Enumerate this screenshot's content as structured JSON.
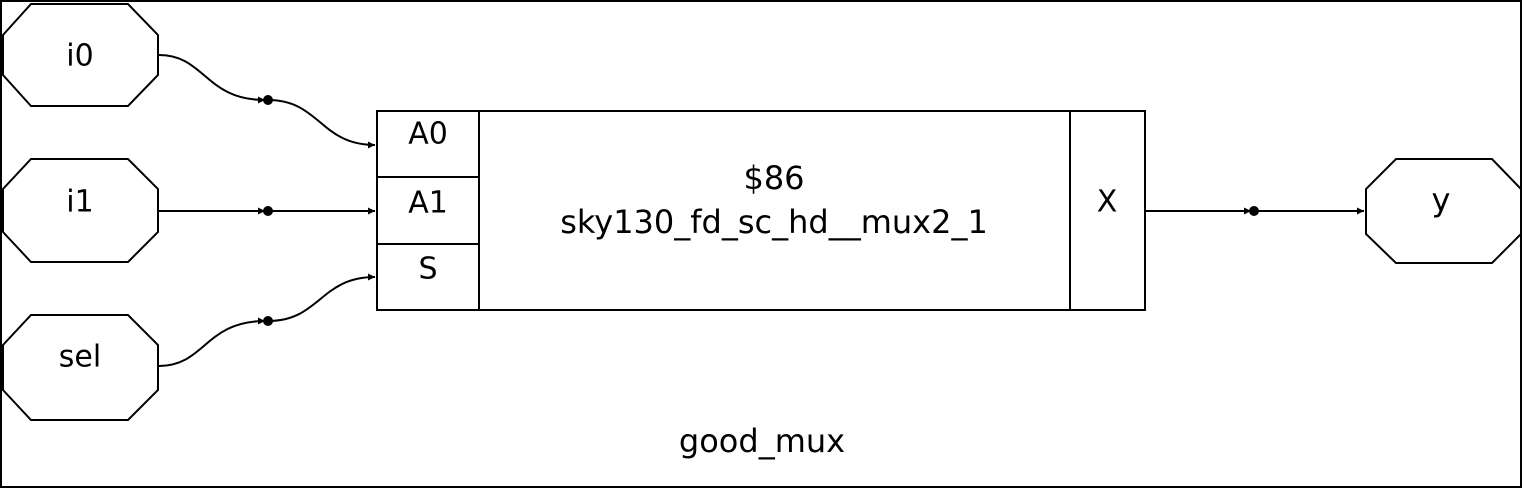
{
  "module": {
    "name": "good_mux"
  },
  "inputs": [
    {
      "id": "i0",
      "label": "i0"
    },
    {
      "id": "i1",
      "label": "i1"
    },
    {
      "id": "sel",
      "label": "sel"
    }
  ],
  "outputs": [
    {
      "id": "y",
      "label": "y"
    }
  ],
  "cell": {
    "instance": "$86",
    "type": "sky130_fd_sc_hd__mux2_1",
    "in_ports": [
      "A0",
      "A1",
      "S"
    ],
    "out_ports": [
      "X"
    ]
  },
  "colors": {
    "stroke": "#000000",
    "fill": "#ffffff"
  }
}
